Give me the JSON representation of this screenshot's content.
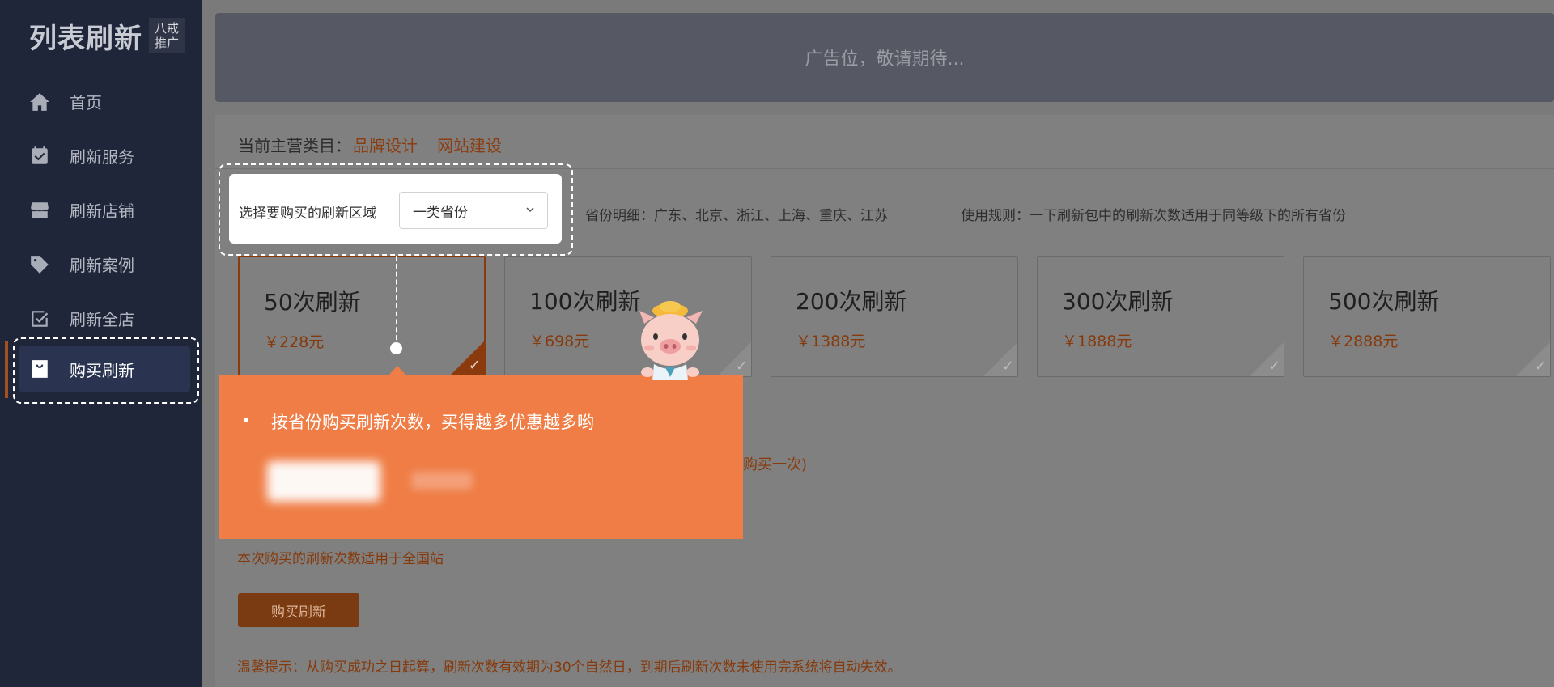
{
  "logo": {
    "main": "列表刷新",
    "sub_line1": "八戒",
    "sub_line2": "推广"
  },
  "sidebar": {
    "items": [
      {
        "label": "首页",
        "icon": "home-icon"
      },
      {
        "label": "刷新服务",
        "icon": "calendar-check-icon"
      },
      {
        "label": "刷新店铺",
        "icon": "store-icon"
      },
      {
        "label": "刷新案例",
        "icon": "tag-icon"
      },
      {
        "label": "刷新全店",
        "icon": "checklist-icon"
      },
      {
        "label": "购买刷新",
        "icon": "shopping-bag-icon",
        "active": true
      }
    ]
  },
  "ad_banner": {
    "text": "广告位，敬请期待..."
  },
  "category": {
    "label": "当前主营类目：",
    "items": [
      "品牌设计",
      "网站建设"
    ]
  },
  "region": {
    "label": "选择要购买的刷新区域",
    "selected": "一类省份",
    "province_detail": "省份明细：广东、北京、浙江、上海、重庆、江苏",
    "usage_rule": "使用规则：一下刷新包中的刷新次数适用于同等级下的所有省份"
  },
  "packages": [
    {
      "title": "50次刷新",
      "price": "￥228元",
      "selected": true
    },
    {
      "title": "100次刷新",
      "price": "￥698元",
      "selected": false
    },
    {
      "title": "200次刷新",
      "price": "￥1388元",
      "selected": false
    },
    {
      "title": "300次刷新",
      "price": "￥1888元",
      "selected": false
    },
    {
      "title": "500次刷新",
      "price": "￥2888元",
      "selected": false
    }
  ],
  "notes": {
    "buy_once_partial": "购买一次)",
    "scope": "本次购买的刷新次数适用于全国站",
    "buy_button": "购买刷新",
    "warm_tip": "温馨提示：从购买成功之日起算，刷新次数有效期为30个自然日，到期后刷新次数未使用完系统将自动失效。"
  },
  "guide": {
    "tip_text": "按省份购买刷新次数，买得越多优惠越多哟"
  },
  "colors": {
    "sidebar_bg": "#202639",
    "accent_orange": "#ef7d45",
    "price_brown": "#86390b",
    "active_item_bg": "#2a3450"
  }
}
